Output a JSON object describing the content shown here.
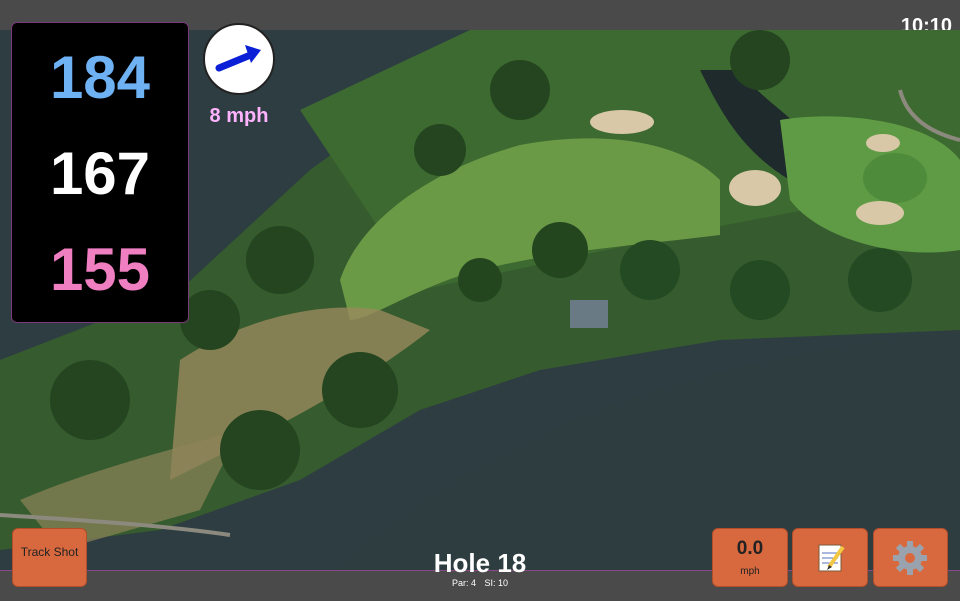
{
  "status": {
    "time": "10:10"
  },
  "yardages": {
    "back": "184",
    "middle": "167",
    "front": "155"
  },
  "wind": {
    "speed": "8 mph",
    "direction_icon": "arrow-right-up-icon"
  },
  "buttons": {
    "track_shot": "Track Shot",
    "speed_value": "0.0",
    "speed_unit": "mph",
    "notes_icon": "notepad-icon",
    "settings_icon": "gear-icon"
  },
  "hole": {
    "title": "Hole 18",
    "par": "Par: 4",
    "si": "SI: 10"
  },
  "colors": {
    "button": "#d8693f",
    "back": "#6fb2f4",
    "front": "#f07fc2",
    "wind_text": "#ffb3ff"
  }
}
